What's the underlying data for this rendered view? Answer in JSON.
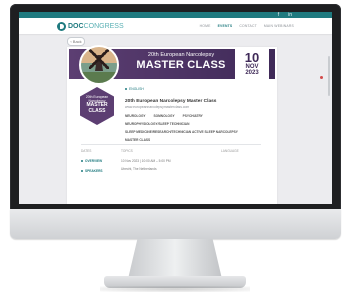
{
  "window": {
    "social_icons": [
      "f",
      "in"
    ]
  },
  "nav": {
    "logo_doc": "DOC",
    "logo_congress": "CONGRESS",
    "links": [
      "HOME",
      "EVENTS",
      "CONTACT",
      "MAIN WEBINARS"
    ]
  },
  "event": {
    "back_label": "‹ Back",
    "banner_line1": "20th European Narcolepsy",
    "banner_line2": "MASTER CLASS",
    "date_day": "10",
    "date_month": "NOV",
    "date_year": "2023",
    "hex_line1": "20th European Narcolepsy",
    "hex_line2": "MASTER CLASS",
    "lang_label": "ENGLISH",
    "title": "20th European Narcolepsy Master Class",
    "subtitle": "www.europeannarcolepsymasterclass.com",
    "tags": [
      "NEUROLOGY",
      "SOMNOLOGY",
      "PSYCHIATRY",
      "NEUROPHYSIOLOGY/SLEEP TECHNICIAN",
      "SLEEP MEDICINE/RESEARCH/TECHNICIAN ACTIVE SLEEP NARCOLEPSY",
      "MASTER CLASS"
    ]
  },
  "details": {
    "col1": "DATES",
    "col2": "TOPICS",
    "col3": "LANGUAGE",
    "side_items": [
      "OVERVIEW",
      "SPEAKERS"
    ],
    "rows": [
      "10 Nov 2023 | 10:00 AM – 5:00 PM",
      "Utrecht, The Netherlands"
    ]
  }
}
